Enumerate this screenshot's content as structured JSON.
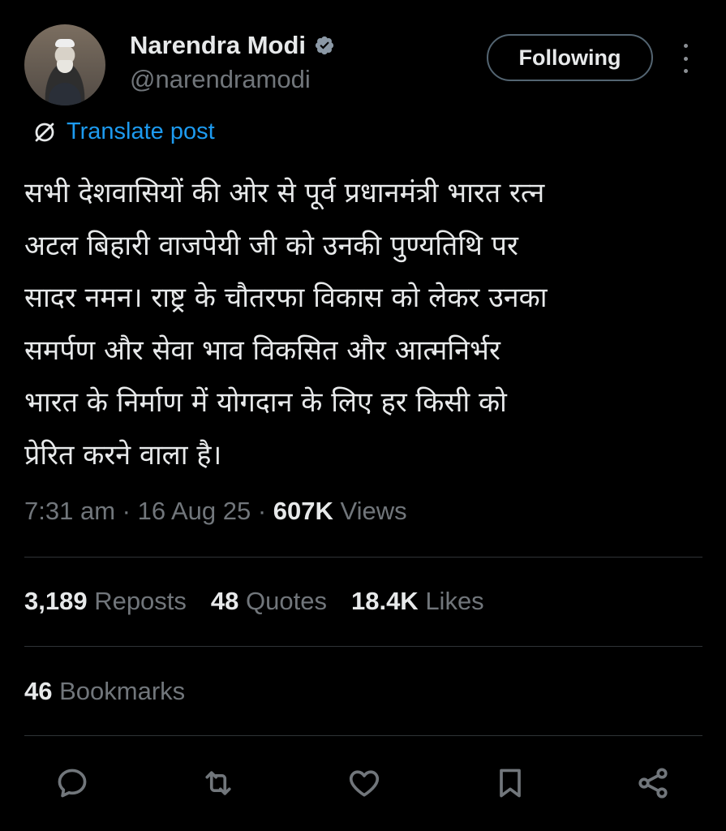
{
  "author": {
    "name": "Narendra Modi",
    "handle": "@narendramodi",
    "verified_color": "#8b98a5"
  },
  "follow_label": "Following",
  "translate_label": "Translate post",
  "post_text": "सभी देशवासियों की ओर से पूर्व प्रधानमंत्री भारत रत्न\nअटल बिहारी वाजपेयी जी को उनकी पुण्यतिथि पर\nसादर नमन। राष्ट्र के चौतरफा विकास को लेकर उनका\nसमर्पण और सेवा भाव विकसित और आत्मनिर्भर\nभारत के निर्माण में योगदान के लिए हर किसी को\nप्रेरित करने वाला है।",
  "meta": {
    "time": "7:31 am",
    "sep1": " · ",
    "date": "16 Aug 25",
    "sep2": " · ",
    "views_count": "607K",
    "views_label": " Views"
  },
  "stats": {
    "reposts_count": "3,189",
    "reposts_label": " Reposts",
    "quotes_count": "48",
    "quotes_label": " Quotes",
    "likes_count": "18.4K",
    "likes_label": " Likes",
    "bookmarks_count": "46",
    "bookmarks_label": " Bookmarks"
  },
  "actions": [
    "reply-icon",
    "repost-icon",
    "like-icon",
    "bookmark-icon",
    "share-icon"
  ],
  "colors": {
    "background": "#000000",
    "text": "#e7e9ea",
    "muted": "#71767b",
    "link": "#1d9bf0",
    "divider": "#2f3336"
  }
}
